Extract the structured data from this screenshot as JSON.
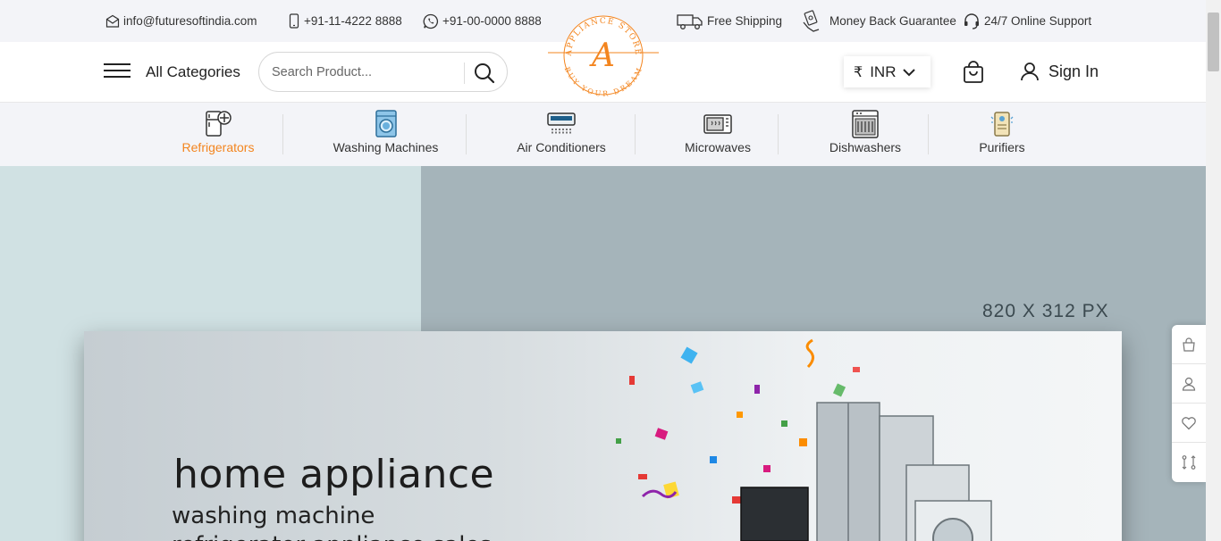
{
  "topbar": {
    "email": "info@futuresoftindia.com",
    "phone": "+91-11-4222 8888",
    "whatsapp": "+91-00-0000 8888",
    "shipping": "Free Shipping",
    "guarantee": "Money Back Guarantee",
    "support": "24/7 Online Support"
  },
  "header": {
    "all_categories": "All Categories",
    "search_placeholder": "Search Product...",
    "logo_ring_top": "APPLIANCE STORE",
    "logo_ring_bottom": "BUY YOUR DREAM",
    "logo_letter": "A",
    "currency_symbol": "₹",
    "currency": "INR",
    "sign_in": "Sign In"
  },
  "categories": [
    {
      "label": "Refrigerators",
      "icon": "refrigerator-icon",
      "active": true
    },
    {
      "label": "Washing Machines",
      "icon": "washing-machine-icon",
      "active": false
    },
    {
      "label": "Air Conditioners",
      "icon": "air-conditioner-icon",
      "active": false
    },
    {
      "label": "Microwaves",
      "icon": "microwave-icon",
      "active": false
    },
    {
      "label": "Dishwashers",
      "icon": "dishwasher-icon",
      "active": false
    },
    {
      "label": "Purifiers",
      "icon": "purifier-icon",
      "active": false
    }
  ],
  "banner": {
    "size_label": "820 X 312 PX",
    "headline": "home appliance",
    "line1": "washing machine",
    "line2": "refrigerator appliance sales"
  },
  "side_toolbar": [
    "cart-icon",
    "user-icon",
    "heart-icon",
    "compare-icon"
  ],
  "colors": {
    "accent": "#f3851f",
    "topbar_bg": "#f3f4f8",
    "banner_bg": "#a5b4ba",
    "banner_left": "#d0e1e3"
  }
}
